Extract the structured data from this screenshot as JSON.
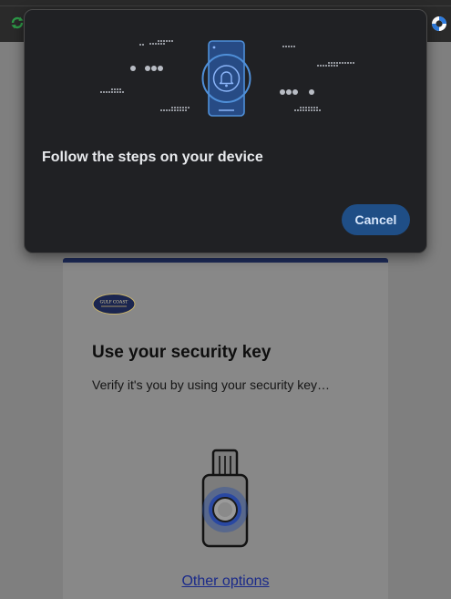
{
  "browser": {
    "left_icon": "sync-extension-icon",
    "right_icon": "lifebuoy-icon"
  },
  "background_page": {
    "logo_text": "GULF COAST",
    "title": "Use your security key",
    "subtitle": "Verify it's you by using your security key…",
    "other_options_link": "Other options",
    "accent_color": "#1d2a57",
    "key_icon": "usb-security-key-icon"
  },
  "dialog": {
    "illustration_icon": "phone-notification-bell-icon",
    "title": "Follow the steps on your device",
    "cancel_label": "Cancel",
    "accent_color": "#4f8fd8"
  }
}
